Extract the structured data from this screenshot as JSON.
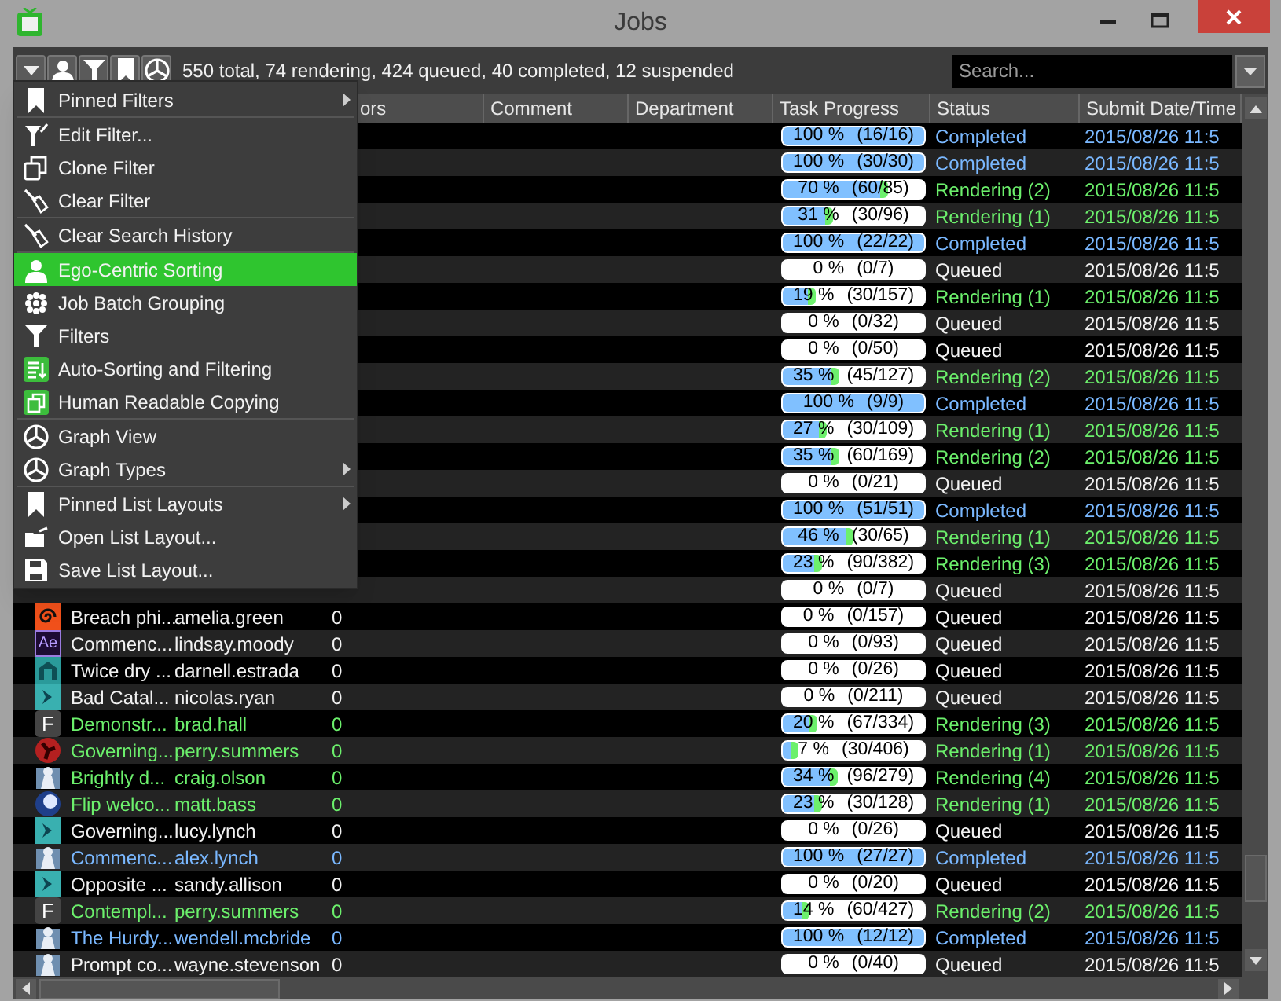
{
  "window": {
    "title": "Jobs"
  },
  "toolbar": {
    "summary": "550 total, 74 rendering, 424 queued, 40 completed, 12 suspended",
    "search": {
      "placeholder": "Search..."
    }
  },
  "menu": {
    "groups": [
      [
        {
          "label": "Pinned Filters",
          "arrow": true,
          "selected": false
        }
      ],
      [
        {
          "label": "Edit Filter...",
          "arrow": false,
          "selected": false
        },
        {
          "label": "Clone Filter",
          "arrow": false,
          "selected": false
        },
        {
          "label": "Clear Filter",
          "arrow": false,
          "selected": false
        }
      ],
      [
        {
          "label": "Clear Search History",
          "arrow": false,
          "selected": false
        }
      ],
      [
        {
          "label": "Ego-Centric Sorting",
          "arrow": false,
          "selected": true
        },
        {
          "label": "Job Batch Grouping",
          "arrow": false,
          "selected": false
        },
        {
          "label": "Filters",
          "arrow": false,
          "selected": false
        },
        {
          "label": "Auto-Sorting and Filtering",
          "arrow": false,
          "selected": false
        },
        {
          "label": "Human Readable Copying",
          "arrow": false,
          "selected": false
        }
      ],
      [
        {
          "label": "Graph View",
          "arrow": false,
          "selected": false
        },
        {
          "label": "Graph Types",
          "arrow": true,
          "selected": false
        }
      ],
      [
        {
          "label": "Pinned List Layouts",
          "arrow": true,
          "selected": false
        },
        {
          "label": "Open List Layout...",
          "arrow": false,
          "selected": false
        },
        {
          "label": "Save List Layout...",
          "arrow": false,
          "selected": false
        }
      ]
    ]
  },
  "table": {
    "columns": [
      {
        "label": "ors"
      },
      {
        "label": "Comment"
      },
      {
        "label": "Department"
      },
      {
        "label": "Task Progress"
      },
      {
        "label": "Status"
      },
      {
        "label": "Submit Date/Time"
      }
    ],
    "rows": [
      {
        "percent": "100 %",
        "tasks": "(16/16)",
        "level": 1,
        "kind": "completed",
        "status": "Completed",
        "submitted": "2015/08/26 11:5"
      },
      {
        "percent": "100 %",
        "tasks": "(30/30)",
        "level": 1,
        "kind": "completed",
        "status": "Completed",
        "submitted": "2015/08/26 11:5"
      },
      {
        "percent": "70 %",
        "tasks": "(60/85)",
        "level": 0.7,
        "kind": "rendering",
        "status": "Rendering (2)",
        "submitted": "2015/08/26 11:5"
      },
      {
        "percent": "31 %",
        "tasks": "(30/96)",
        "level": 0.31,
        "kind": "rendering",
        "status": "Rendering (1)",
        "submitted": "2015/08/26 11:5"
      },
      {
        "percent": "100 %",
        "tasks": "(22/22)",
        "level": 1,
        "kind": "completed",
        "status": "Completed",
        "submitted": "2015/08/26 11:5"
      },
      {
        "percent": "0 %",
        "tasks": "(0/7)",
        "level": 0,
        "kind": "queued",
        "status": "Queued",
        "submitted": "2015/08/26 11:5"
      },
      {
        "percent": "19 %",
        "tasks": "(30/157)",
        "level": 0.19,
        "kind": "rendering",
        "status": "Rendering (1)",
        "submitted": "2015/08/26 11:5"
      },
      {
        "percent": "0 %",
        "tasks": "(0/32)",
        "level": 0,
        "kind": "queued",
        "status": "Queued",
        "submitted": "2015/08/26 11:5"
      },
      {
        "percent": "0 %",
        "tasks": "(0/50)",
        "level": 0,
        "kind": "queued",
        "status": "Queued",
        "submitted": "2015/08/26 11:5"
      },
      {
        "percent": "35 %",
        "tasks": "(45/127)",
        "level": 0.35,
        "kind": "rendering",
        "status": "Rendering (2)",
        "submitted": "2015/08/26 11:5"
      },
      {
        "percent": "100 %",
        "tasks": "(9/9)",
        "level": 1,
        "kind": "completed",
        "status": "Completed",
        "submitted": "2015/08/26 11:5"
      },
      {
        "percent": "27 %",
        "tasks": "(30/109)",
        "level": 0.27,
        "kind": "rendering",
        "status": "Rendering (1)",
        "submitted": "2015/08/26 11:5"
      },
      {
        "percent": "35 %",
        "tasks": "(60/169)",
        "level": 0.35,
        "kind": "rendering",
        "status": "Rendering (2)",
        "submitted": "2015/08/26 11:5"
      },
      {
        "percent": "0 %",
        "tasks": "(0/21)",
        "level": 0,
        "kind": "queued",
        "status": "Queued",
        "submitted": "2015/08/26 11:5"
      },
      {
        "percent": "100 %",
        "tasks": "(51/51)",
        "level": 1,
        "kind": "completed",
        "status": "Completed",
        "submitted": "2015/08/26 11:5"
      },
      {
        "percent": "46 %",
        "tasks": "(30/65)",
        "level": 0.46,
        "kind": "rendering",
        "status": "Rendering (1)",
        "submitted": "2015/08/26 11:5"
      },
      {
        "percent": "23 %",
        "tasks": "(90/382)",
        "level": 0.23,
        "kind": "rendering",
        "status": "Rendering (3)",
        "submitted": "2015/08/26 11:5"
      },
      {
        "percent": "0 %",
        "tasks": "(0/7)",
        "level": 0,
        "kind": "queued",
        "status": "Queued",
        "submitted": "2015/08/26 11:5"
      },
      {
        "job": "Breach phi...",
        "user": "amelia.green",
        "errors": "0",
        "percent": "0 %",
        "tasks": "(0/157)",
        "level": 0,
        "kind": "queued",
        "status": "Queued",
        "submitted": "2015/08/26 11:5"
      },
      {
        "icon_text": "Ae",
        "job": "Commenc...",
        "user": "lindsay.moody",
        "errors": "0",
        "percent": "0 %",
        "tasks": "(0/93)",
        "level": 0,
        "kind": "queued",
        "status": "Queued",
        "submitted": "2015/08/26 11:5"
      },
      {
        "job": "Twice dry ...",
        "user": "darnell.estrada",
        "errors": "0",
        "percent": "0 %",
        "tasks": "(0/26)",
        "level": 0,
        "kind": "queued",
        "status": "Queued",
        "submitted": "2015/08/26 11:5"
      },
      {
        "job": "Bad Catal...",
        "user": "nicolas.ryan",
        "errors": "0",
        "percent": "0 %",
        "tasks": "(0/211)",
        "level": 0,
        "kind": "queued",
        "status": "Queued",
        "submitted": "2015/08/26 11:5"
      },
      {
        "icon_text": "F",
        "job": "Demonstr...",
        "user": "brad.hall",
        "errors": "0",
        "percent": "20 %",
        "tasks": "(67/334)",
        "level": 0.2,
        "kind": "rendering",
        "status": "Rendering (3)",
        "submitted": "2015/08/26 11:5"
      },
      {
        "job": "Governing...",
        "user": "perry.summers",
        "errors": "0",
        "percent": "7 %",
        "tasks": "(30/406)",
        "level": 0.07,
        "kind": "rendering",
        "status": "Rendering (1)",
        "submitted": "2015/08/26 11:5"
      },
      {
        "job": "Brightly d...",
        "user": "craig.olson",
        "errors": "0",
        "percent": "34 %",
        "tasks": "(96/279)",
        "level": 0.34,
        "kind": "rendering",
        "status": "Rendering (4)",
        "submitted": "2015/08/26 11:5"
      },
      {
        "job": "Flip welco...",
        "user": "matt.bass",
        "errors": "0",
        "percent": "23 %",
        "tasks": "(30/128)",
        "level": 0.23,
        "kind": "rendering",
        "status": "Rendering (1)",
        "submitted": "2015/08/26 11:5"
      },
      {
        "job": "Governing...",
        "user": "lucy.lynch",
        "errors": "0",
        "percent": "0 %",
        "tasks": "(0/26)",
        "level": 0,
        "kind": "queued",
        "status": "Queued",
        "submitted": "2015/08/26 11:5"
      },
      {
        "job": "Commenc...",
        "user": "alex.lynch",
        "errors": "0",
        "percent": "100 %",
        "tasks": "(27/27)",
        "level": 1,
        "kind": "completed",
        "status": "Completed",
        "submitted": "2015/08/26 11:5"
      },
      {
        "job": "Opposite ...",
        "user": "sandy.allison",
        "errors": "0",
        "percent": "0 %",
        "tasks": "(0/20)",
        "level": 0,
        "kind": "queued",
        "status": "Queued",
        "submitted": "2015/08/26 11:5"
      },
      {
        "icon_text": "F",
        "job": "Contempl...",
        "user": "perry.summers",
        "errors": "0",
        "percent": "14 %",
        "tasks": "(60/427)",
        "level": 0.14,
        "kind": "rendering",
        "status": "Rendering (2)",
        "submitted": "2015/08/26 11:5"
      },
      {
        "job": "The Hurdy...",
        "user": "wendell.mcbride",
        "errors": "0",
        "percent": "100 %",
        "tasks": "(12/12)",
        "level": 1,
        "kind": "completed",
        "status": "Completed",
        "submitted": "2015/08/26 11:5"
      },
      {
        "job": "Prompt co...",
        "user": "wayne.stevenson",
        "errors": "0",
        "percent": "0 %",
        "tasks": "(0/40)",
        "level": 0,
        "kind": "queued",
        "status": "Queued",
        "submitted": "2015/08/26 11:5"
      }
    ]
  }
}
